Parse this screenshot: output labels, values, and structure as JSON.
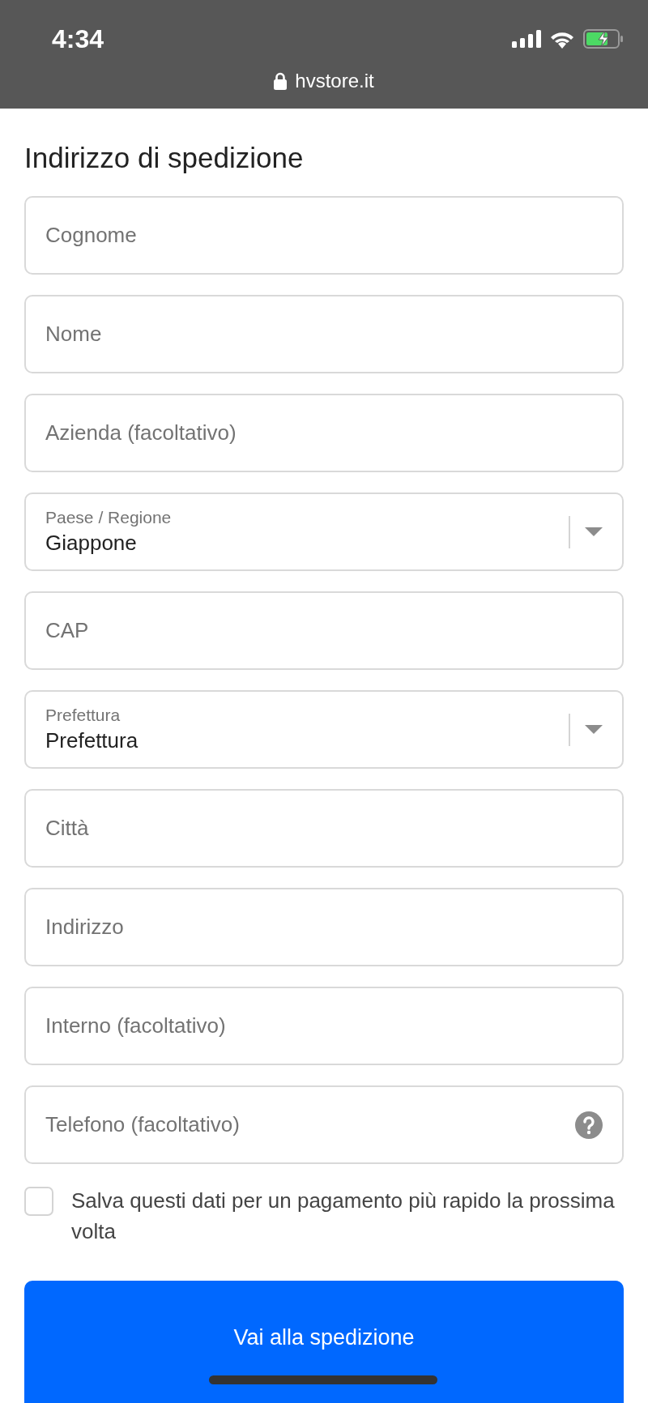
{
  "status_bar": {
    "time": "4:34",
    "url": "hvstore.it"
  },
  "title": "Indirizzo di spedizione",
  "fields": [
    {
      "kind": "text",
      "placeholder": "Cognome"
    },
    {
      "kind": "text",
      "placeholder": "Nome"
    },
    {
      "kind": "text",
      "placeholder": "Azienda (facoltativo)"
    },
    {
      "kind": "select",
      "label": "Paese / Regione",
      "value": "Giappone"
    },
    {
      "kind": "text",
      "placeholder": "CAP"
    },
    {
      "kind": "select",
      "label": "Prefettura",
      "value": "Prefettura"
    },
    {
      "kind": "text",
      "placeholder": "Città"
    },
    {
      "kind": "text",
      "placeholder": "Indirizzo"
    },
    {
      "kind": "text",
      "placeholder": "Interno (facoltativo)"
    },
    {
      "kind": "text_help",
      "placeholder": "Telefono (facoltativo)"
    }
  ],
  "save_option": {
    "label": "Salva questi dati per un pagamento più rapido la prossima volta",
    "checked": false
  },
  "submit_button": "Vai alla spedizione"
}
